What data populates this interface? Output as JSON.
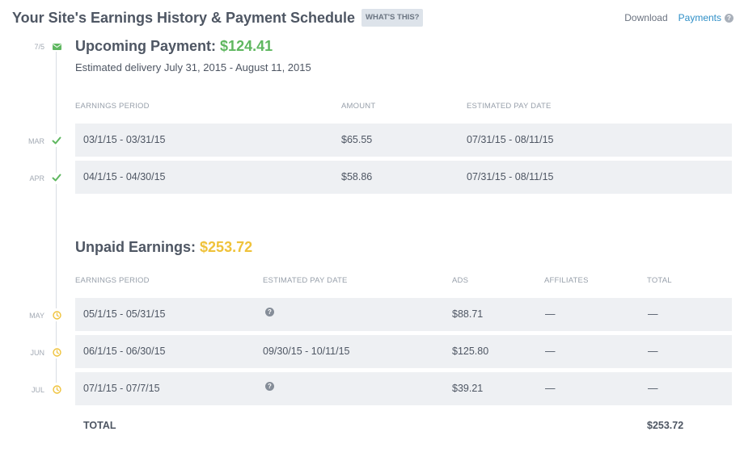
{
  "header": {
    "title": "Your Site's Earnings History & Payment Schedule",
    "whats_this": "WHAT'S THIS?",
    "download": "Download",
    "payments": "Payments",
    "help_glyph": "?"
  },
  "upcoming": {
    "label": "Upcoming Payment:",
    "amount": "$124.41",
    "date_marker": "7/5",
    "delivery": "Estimated delivery July 31, 2015 - August 11, 2015",
    "columns": [
      "EARNINGS PERIOD",
      "AMOUNT",
      "ESTIMATED PAY DATE"
    ],
    "rows": [
      {
        "month": "MAR",
        "period": "03/1/15 - 03/31/15",
        "amount": "$65.55",
        "pay_date": "07/31/15 - 08/11/15"
      },
      {
        "month": "APR",
        "period": "04/1/15 - 04/30/15",
        "amount": "$58.86",
        "pay_date": "07/31/15 - 08/11/15"
      }
    ]
  },
  "unpaid": {
    "label": "Unpaid Earnings:",
    "amount": "$253.72",
    "columns": [
      "EARNINGS PERIOD",
      "ESTIMATED PAY DATE",
      "ADS",
      "AFFILIATES",
      "TOTAL"
    ],
    "rows": [
      {
        "month": "MAY",
        "period": "05/1/15 - 05/31/15",
        "pay_date": "?",
        "ads": "$88.71",
        "affiliates": "—",
        "total": "—"
      },
      {
        "month": "JUN",
        "period": "06/1/15 - 06/30/15",
        "pay_date": "09/30/15 - 10/11/15",
        "ads": "$125.80",
        "affiliates": "—",
        "total": "—"
      },
      {
        "month": "JUL",
        "period": "07/1/15 - 07/7/15",
        "pay_date": "?",
        "ads": "$39.21",
        "affiliates": "—",
        "total": "—"
      }
    ],
    "total_label": "TOTAL",
    "total_value": "$253.72"
  },
  "colors": {
    "green": "#5fb760",
    "yellow": "#efc23a",
    "link": "#2f8fc7",
    "row_bg": "#eef0f3"
  },
  "icons": {
    "sent": "mail-icon",
    "paid": "check-icon",
    "pending": "clock-icon",
    "unknown": "help-icon"
  }
}
